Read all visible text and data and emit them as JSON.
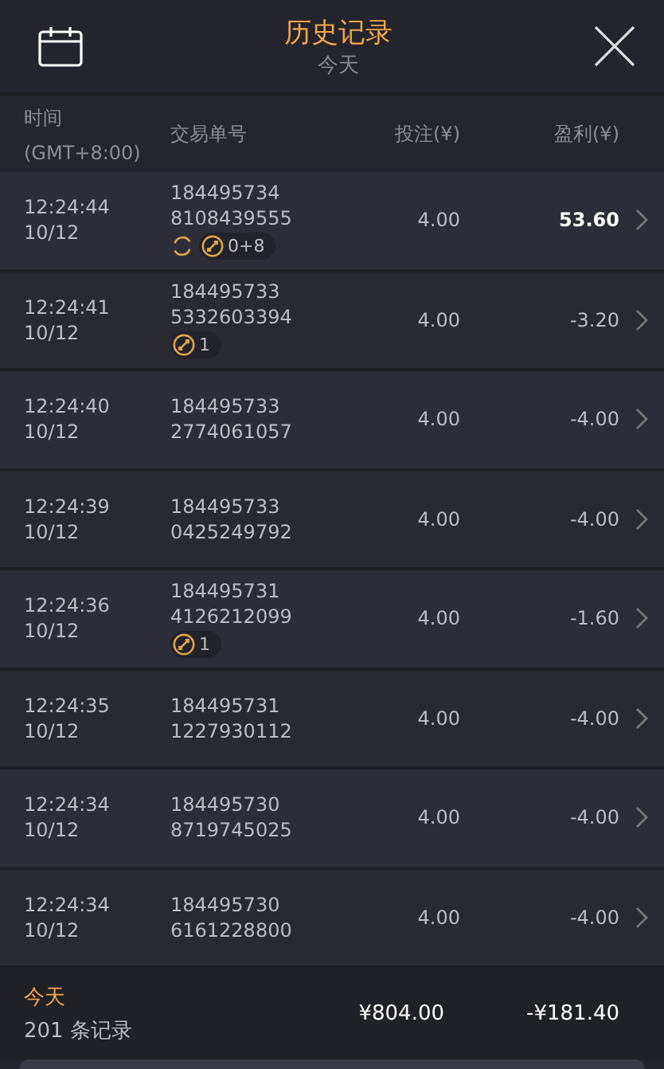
{
  "header": {
    "title": "历史记录",
    "subtitle": "今天"
  },
  "columns": {
    "time": "时间",
    "timezone": "(GMT+8:00)",
    "order": "交易单号",
    "stake": "投注(¥)",
    "profit": "盈利(¥)"
  },
  "rows": [
    {
      "time": "12:24:44",
      "date": "10/12",
      "order_1": "184495734",
      "order_2": "8108439555",
      "stake": "4.00",
      "profit": "53.60",
      "win": true,
      "badges": [
        {
          "kind": "cycle"
        },
        {
          "kind": "coin",
          "text": "0+8"
        }
      ]
    },
    {
      "time": "12:24:41",
      "date": "10/12",
      "order_1": "184495733",
      "order_2": "5332603394",
      "stake": "4.00",
      "profit": "-3.20",
      "win": false,
      "badges": [
        {
          "kind": "coin",
          "text": "1"
        }
      ]
    },
    {
      "time": "12:24:40",
      "date": "10/12",
      "order_1": "184495733",
      "order_2": "2774061057",
      "stake": "4.00",
      "profit": "-4.00",
      "win": false,
      "badges": []
    },
    {
      "time": "12:24:39",
      "date": "10/12",
      "order_1": "184495733",
      "order_2": "0425249792",
      "stake": "4.00",
      "profit": "-4.00",
      "win": false,
      "badges": []
    },
    {
      "time": "12:24:36",
      "date": "10/12",
      "order_1": "184495731",
      "order_2": "4126212099",
      "stake": "4.00",
      "profit": "-1.60",
      "win": false,
      "badges": [
        {
          "kind": "coin",
          "text": "1"
        }
      ]
    },
    {
      "time": "12:24:35",
      "date": "10/12",
      "order_1": "184495731",
      "order_2": "1227930112",
      "stake": "4.00",
      "profit": "-4.00",
      "win": false,
      "badges": []
    },
    {
      "time": "12:24:34",
      "date": "10/12",
      "order_1": "184495730",
      "order_2": "8719745025",
      "stake": "4.00",
      "profit": "-4.00",
      "win": false,
      "badges": []
    },
    {
      "time": "12:24:34",
      "date": "10/12",
      "order_1": "184495730",
      "order_2": "6161228800",
      "stake": "4.00",
      "profit": "-4.00",
      "win": false,
      "badges": []
    }
  ],
  "footer": {
    "period": "今天",
    "count": "201 条记录",
    "stake_total": "¥804.00",
    "profit_total": "-¥181.40"
  }
}
